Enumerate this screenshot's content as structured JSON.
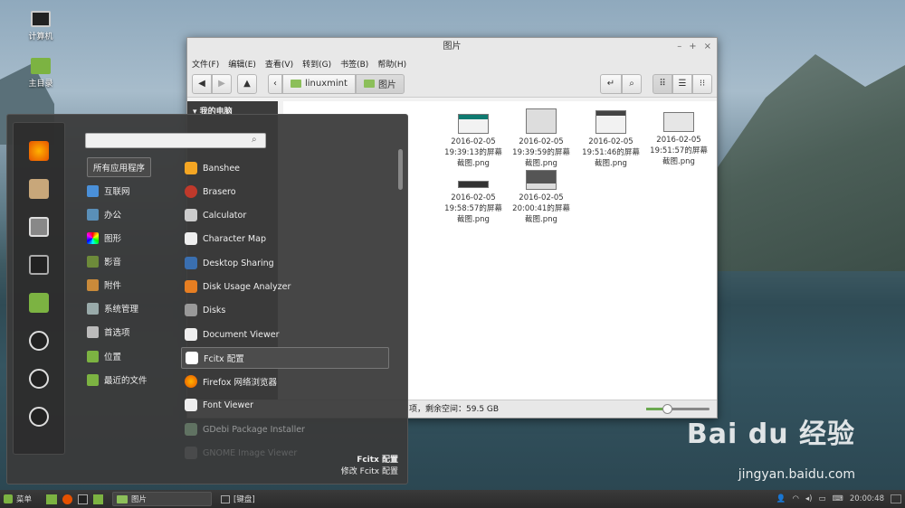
{
  "desktop": {
    "icons": [
      {
        "label": "计算机",
        "icon": "computer-icon"
      },
      {
        "label": "主目录",
        "icon": "home-folder-icon"
      }
    ]
  },
  "file_manager": {
    "title": "图片",
    "window_buttons": [
      "–",
      "+",
      "×"
    ],
    "menubar": [
      "文件(F)",
      "编辑(E)",
      "查看(V)",
      "转到(G)",
      "书签(B)",
      "帮助(H)"
    ],
    "breadcrumb": [
      "linuxmint",
      "图片"
    ],
    "sidebar": {
      "heading": "我的电脑"
    },
    "files": [
      {
        "name": "2016-02-05 19:39:13的屏幕截图.png",
        "line1": "2016-02-05",
        "line2": "19:39:13的屏幕",
        "line3": "截图.png"
      },
      {
        "name": "2016-02-05 19:39:59的屏幕截图.png",
        "line1": "2016-02-05",
        "line2": "19:39:59的屏幕",
        "line3": "截图.png"
      },
      {
        "name": "2016-02-05 19:51:46的屏幕截图.png",
        "line1": "2016-02-05",
        "line2": "19:51:46的屏幕",
        "line3": "截图.png"
      },
      {
        "name": "2016-02-05 19:51:57的屏幕截图.png",
        "line1": "2016-02-05",
        "line2": "19:51:57的屏幕",
        "line3": "截图.png"
      },
      {
        "name": "2016-02-05 19:58:57的屏幕截图.png",
        "line1": "2016-02-05",
        "line2": "19:58:57的屏幕",
        "line3": "截图.png"
      },
      {
        "name": "2016-02-05 20:00:41的屏幕截图.png",
        "line1": "2016-02-05",
        "line2": "20:00:41的屏幕",
        "line3": "截图.png"
      }
    ],
    "status": "项，剩余空间：59.5 GB",
    "zoom_level_percent": 35
  },
  "menu": {
    "search_placeholder": "",
    "categories": [
      "所有应用程序",
      "互联网",
      "办公",
      "图形",
      "影音",
      "附件",
      "系统管理",
      "首选项",
      "位置",
      "最近的文件"
    ],
    "apps": [
      "Banshee",
      "Brasero",
      "Calculator",
      "Character Map",
      "Desktop Sharing",
      "Disk Usage Analyzer",
      "Disks",
      "Document Viewer",
      "Fcitx 配置",
      "Firefox 网络浏览器",
      "Font Viewer",
      "GDebi Package Installer",
      "GNOME Image Viewer"
    ],
    "selected_app": "Fcitx 配置",
    "description_title": "Fcitx 配置",
    "description_text": "修改 Fcitx 配置"
  },
  "taskbar": {
    "menu_label": "菜单",
    "windows": [
      "图片",
      "[键盘]"
    ],
    "clock": "20:00:48"
  },
  "watermark": {
    "brand": "Bai du 经验",
    "url": "jingyan.baidu.com"
  }
}
